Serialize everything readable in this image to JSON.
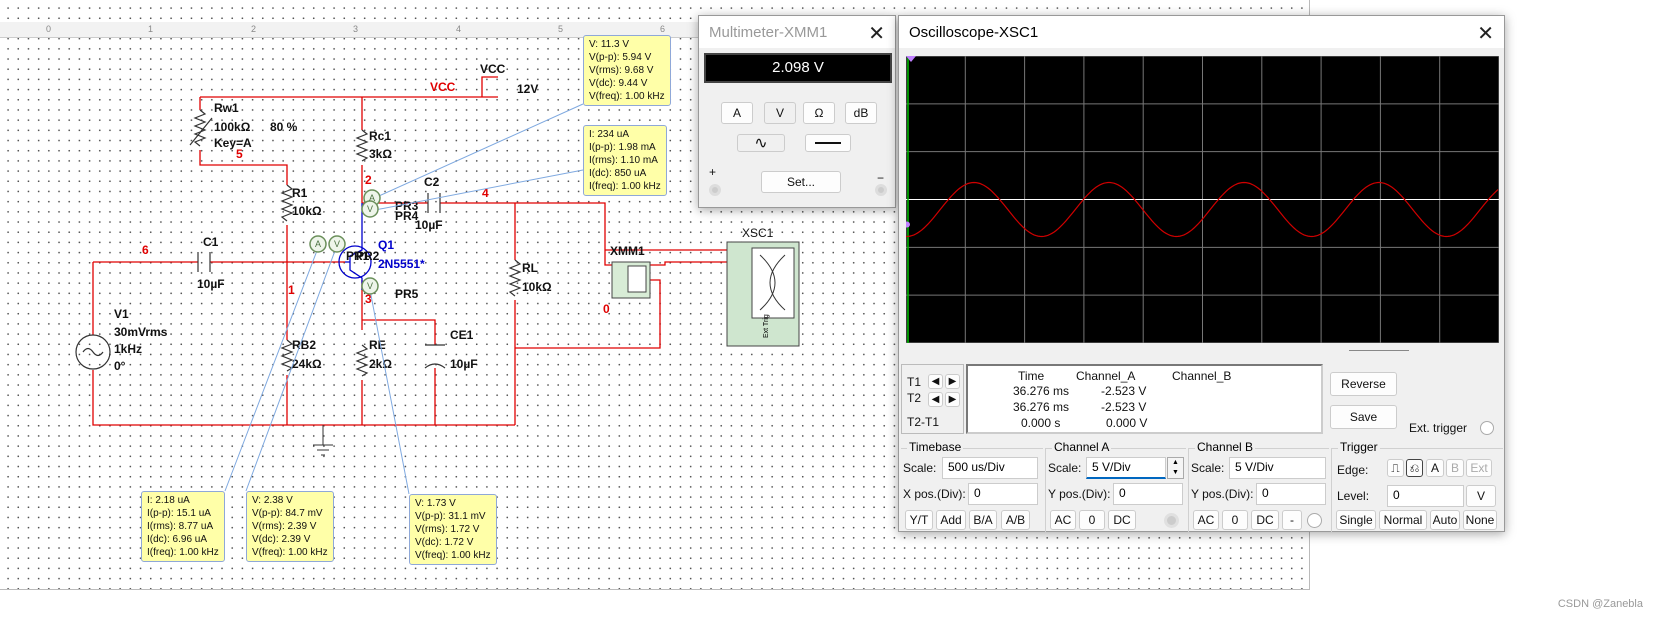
{
  "ruler": {
    "ticks": [
      "0",
      "1",
      "2",
      "3",
      "4",
      "5",
      "6"
    ]
  },
  "circuit": {
    "vcc_net": "VCC",
    "vcc_name": "VCC",
    "vcc_value": "12V",
    "rw1": {
      "name": "Rw1",
      "value": "100kΩ",
      "percent": "80 %",
      "key": "Key=A"
    },
    "r1": {
      "name": "R1",
      "value": "10kΩ"
    },
    "rc1": {
      "name": "Rc1",
      "value": "3kΩ"
    },
    "c1": {
      "name": "C1",
      "value": "10µF"
    },
    "c2": {
      "name": "C2",
      "value": "10µF"
    },
    "q1": {
      "name": "Q1",
      "model": "2N5551*"
    },
    "rb2": {
      "name": "RB2",
      "value": "24kΩ"
    },
    "re": {
      "name": "RE",
      "value": "2kΩ"
    },
    "ce1": {
      "name": "CE1",
      "value": "10µF"
    },
    "rl": {
      "name": "RL",
      "value": "10kΩ"
    },
    "v1": {
      "name": "V1",
      "amp": "30mVrms",
      "freq": "1kHz",
      "phase": "0°"
    },
    "nodes": [
      "6",
      "5",
      "1",
      "2",
      "3",
      "4",
      "0"
    ],
    "probes_labels": [
      "PR3",
      "PR4",
      "PR1",
      "PR2",
      "PR5"
    ],
    "xmm1": "XMM1",
    "xsc1": "XSC1",
    "ext_trig": "Ext Trig"
  },
  "probes": [
    [
      "V: 11.3 V",
      "V(p-p): 5.94 V",
      "V(rms): 9.68 V",
      "V(dc): 9.44 V",
      "V(freq): 1.00 kHz"
    ],
    [
      "I: 234 uA",
      "I(p-p): 1.98 mA",
      "I(rms): 1.10 mA",
      "I(dc): 850 uA",
      "I(freq): 1.00 kHz"
    ],
    [
      "I: 2.18 uA",
      "I(p-p): 15.1 uA",
      "I(rms): 8.77 uA",
      "I(dc): 6.96 uA",
      "I(freq): 1.00 kHz"
    ],
    [
      "V: 2.38 V",
      "V(p-p): 84.7 mV",
      "V(rms): 2.39 V",
      "V(dc): 2.39 V",
      "V(freq): 1.00 kHz"
    ],
    [
      "V: 1.73 V",
      "V(p-p): 31.1 mV",
      "V(rms): 1.72 V",
      "V(dc): 1.72 V",
      "V(freq): 1.00 kHz"
    ]
  ],
  "multimeter": {
    "title": "Multimeter-XMM1",
    "reading": "2.098 V",
    "buttons": [
      "A",
      "V",
      "Ω",
      "dB"
    ],
    "set": "Set...",
    "plus": "+",
    "minus": "−",
    "mode": "ac"
  },
  "scope": {
    "title": "Oscilloscope-XSC1",
    "trace_color": "#d00000",
    "cursor": {
      "t1": "T1",
      "t2": "T2",
      "t21": "T2-T1",
      "headers": [
        "Time",
        "Channel_A",
        "Channel_B"
      ],
      "rows": [
        [
          "36.276 ms",
          "-2.523 V",
          ""
        ],
        [
          "36.276 ms",
          "-2.523 V",
          ""
        ],
        [
          "0.000 s",
          "0.000 V",
          ""
        ]
      ]
    },
    "reverse": "Reverse",
    "save": "Save",
    "ext_trigger": "Ext. trigger",
    "timebase": {
      "label": "Timebase",
      "scale_label": "Scale:",
      "scale": "500 us/Div",
      "xpos_label": "X pos.(Div):",
      "xpos": "0",
      "buttons": [
        "Y/T",
        "Add",
        "B/A",
        "A/B"
      ]
    },
    "channel_a": {
      "label": "Channel A",
      "scale_label": "Scale:",
      "scale": "5  V/Div",
      "ypos_label": "Y pos.(Div):",
      "ypos": "0",
      "buttons": [
        "AC",
        "0",
        "DC"
      ]
    },
    "channel_b": {
      "label": "Channel B",
      "scale_label": "Scale:",
      "scale": "5  V/Div",
      "ypos_label": "Y pos.(Div):",
      "ypos": "0",
      "buttons": [
        "AC",
        "0",
        "DC",
        "-"
      ]
    },
    "trigger": {
      "label": "Trigger",
      "edge_label": "Edge:",
      "edge_buttons": [
        "A",
        "B",
        "Ext"
      ],
      "level_label": "Level:",
      "level": "0",
      "level_unit": "V",
      "modes": [
        "Single",
        "Normal",
        "Auto",
        "None"
      ]
    }
  },
  "watermark": "CSDN @Zanebla"
}
